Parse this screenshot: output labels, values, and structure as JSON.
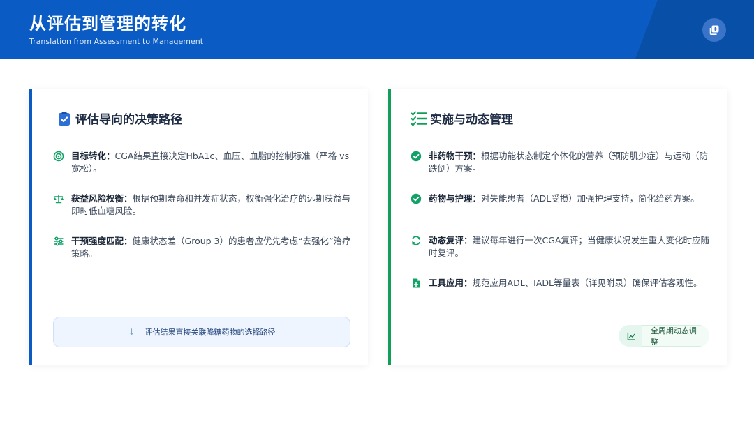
{
  "header": {
    "title": "从评估到管理的转化",
    "subtitle": "Translation from Assessment to Management",
    "icon": "copy-plus-icon"
  },
  "left_card": {
    "title": "评估导向的决策路径",
    "title_icon": "clipboard-check-icon",
    "accent_color": "#0a5cc4",
    "items": [
      {
        "icon": "target-icon",
        "label": "目标转化：",
        "text": "CGA结果直接决定HbA1c、血压、血脂的控制标准（严格 vs 宽松）。"
      },
      {
        "icon": "balance-scale-icon",
        "label": "获益风险权衡：",
        "text": "根据预期寿命和并发症状态，权衡强化治疗的远期获益与即时低血糖风险。"
      },
      {
        "icon": "sliders-icon",
        "label": "干预强度匹配：",
        "text": "健康状态差（Group 3）的患者应优先考虑“去强化”治疗策略。"
      }
    ],
    "footer": {
      "icon": "arrow-down-icon",
      "text": "评估结果直接关联降糖药物的选择路径"
    }
  },
  "right_card": {
    "title": "实施与动态管理",
    "title_icon": "list-check-icon",
    "accent_color": "#109e58",
    "items": [
      {
        "icon": "check-circle-icon",
        "label": "非药物干预：",
        "text": "根据功能状态制定个体化的营养（预防肌少症）与运动（防跌倒）方案。"
      },
      {
        "icon": "check-circle-icon",
        "label": "药物与护理：",
        "text": "对失能患者（ADL受损）加强护理支持，简化给药方案。"
      },
      {
        "icon": "refresh-icon",
        "label": "动态复评：",
        "text": "建议每年进行一次CGA复评；当健康状况发生重大变化时应随时复评。"
      },
      {
        "icon": "file-plus-icon",
        "label": "工具应用：",
        "text": "规范应用ADL、IADL等量表（详见附录）确保评估客观性。"
      }
    ],
    "footer": {
      "icon": "chart-line-icon",
      "text": "全周期动态调整"
    }
  }
}
